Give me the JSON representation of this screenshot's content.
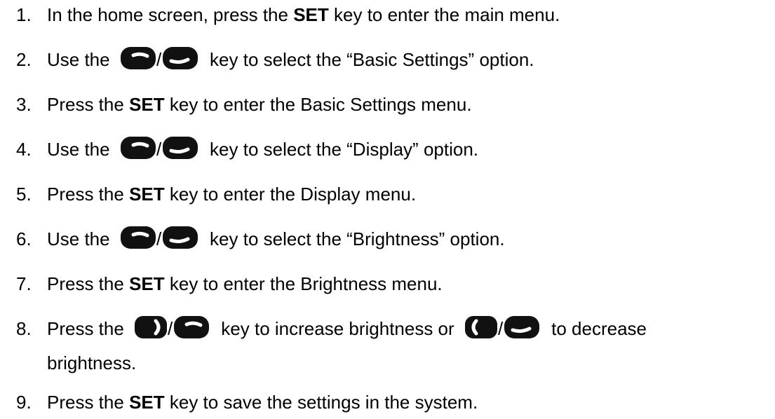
{
  "steps": [
    {
      "num": "1.",
      "pre": "In the home screen, press the ",
      "bold": "SET",
      "post": " key to enter the main menu."
    },
    {
      "num": "2.",
      "pre": "Use the ",
      "keys": "up-down-keys",
      "post": " key to select the “Basic Settings” option."
    },
    {
      "num": "3.",
      "pre": "Press the ",
      "bold": "SET",
      "post": " key to enter the Basic Settings menu."
    },
    {
      "num": "4.",
      "pre": "Use the ",
      "keys": "up-down-keys",
      "post": " key to select the “Display” option."
    },
    {
      "num": "5.",
      "pre": "Press the ",
      "bold": "SET",
      "post": " key to enter the Display menu."
    },
    {
      "num": "6.",
      "pre": "Use the ",
      "keys": "up-down-keys",
      "post": " key to select the “Brightness” option."
    },
    {
      "num": "7.",
      "pre": "Press the ",
      "bold": "SET",
      "post": " key to enter the Brightness menu."
    },
    {
      "num": "8.",
      "pre": "Press the ",
      "keys": "right-up-keys",
      "mid": " key to increase brightness or ",
      "keys2": "left-down-keys",
      "post": " to decrease",
      "cont": "brightness."
    },
    {
      "num": "9.",
      "pre": "Press the ",
      "bold": "SET",
      "post": " key to save the settings in the system."
    }
  ],
  "icons": {
    "up_key": "up-key-icon",
    "down_key": "down-key-icon",
    "right_key": "right-key-icon",
    "left_key": "left-key-icon"
  },
  "colors": {
    "key_fill": "#111111",
    "key_glyph": "#ffffff",
    "text": "#000000"
  }
}
